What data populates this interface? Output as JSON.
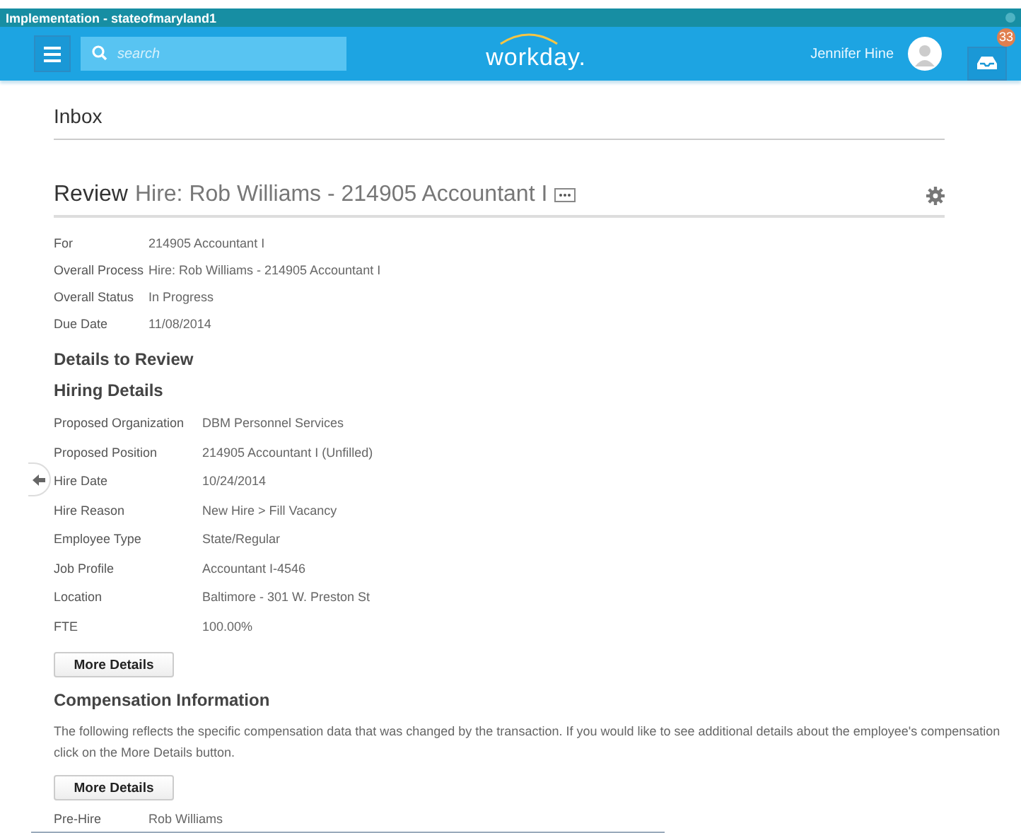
{
  "window": {
    "title": "Implementation - stateofmaryland1"
  },
  "header": {
    "search": {
      "placeholder": "search"
    },
    "logo": "workday.",
    "user": "Jennifer Hine",
    "inbox_count": "33"
  },
  "page_title": "Inbox",
  "review": {
    "label": "Review",
    "title": "Hire: Rob Williams - 214905 Accountant I",
    "fields": [
      {
        "label": "For",
        "value": "214905 Accountant I"
      },
      {
        "label": "Overall Process",
        "value": "Hire: Rob Williams - 214905 Accountant I"
      },
      {
        "label": "Overall Status",
        "value": "In Progress"
      },
      {
        "label": "Due Date",
        "value": "11/08/2014"
      }
    ]
  },
  "details_heading": "Details to Review",
  "hiring": {
    "heading": "Hiring Details",
    "fields": [
      {
        "label": "Proposed Organization",
        "value": "DBM Personnel Services"
      },
      {
        "label": "Proposed Position",
        "value": "214905 Accountant I (Unfilled)"
      },
      {
        "label": "Hire Date",
        "value": "10/24/2014"
      },
      {
        "label": "Hire Reason",
        "value": "New Hire > Fill Vacancy"
      },
      {
        "label": "Employee Type",
        "value": "State/Regular"
      },
      {
        "label": "Job Profile",
        "value": "Accountant I-4546"
      },
      {
        "label": "Location",
        "value": "Baltimore - 301 W. Preston St"
      },
      {
        "label": "FTE",
        "value": "100.00%"
      }
    ],
    "button": "More Details"
  },
  "compensation": {
    "heading": "Compensation Information",
    "text": "The following reflects the specific compensation data that was changed by the transaction. If you would like to see additional details about the employee's compensation click on the More Details button.",
    "button": "More Details",
    "fields": [
      {
        "label": "Pre-Hire",
        "value": "Rob Williams"
      }
    ]
  }
}
